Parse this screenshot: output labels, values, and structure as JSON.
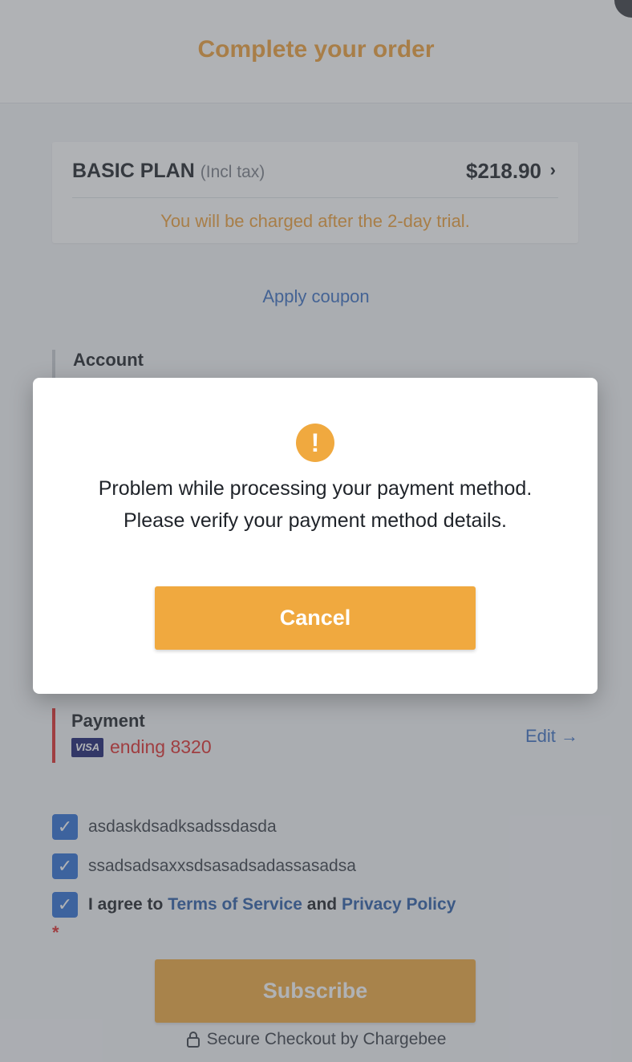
{
  "header": {
    "title": "Complete your order"
  },
  "plan": {
    "name": "BASIC PLAN",
    "tax_note": "(Incl tax)",
    "price": "$218.90",
    "trial_note": "You will be charged after the 2-day trial."
  },
  "coupon": {
    "label": "Apply coupon"
  },
  "account": {
    "title": "Account"
  },
  "payment": {
    "title": "Payment",
    "card_brand": "VISA",
    "card_ending": "ending 8320",
    "edit_label": "Edit →"
  },
  "checkboxes": [
    {
      "label": "asdaskdsadksadssdasda",
      "checked": true
    },
    {
      "label": "ssadsadsaxxsdsasadsadassasadsa",
      "checked": true
    }
  ],
  "agreement": {
    "prefix": "I agree to",
    "terms_link": "Terms of Service",
    "conjunction": "and",
    "privacy_link": "Privacy Policy",
    "required_marker": "*",
    "checked": true
  },
  "subscribe": {
    "label": "Subscribe"
  },
  "secure": {
    "text": "Secure Checkout by Chargebee"
  },
  "modal": {
    "icon": "exclamation-icon",
    "message": "Problem while processing your payment method. Please verify your payment method details.",
    "cancel_label": "Cancel"
  },
  "colors": {
    "accent": "#f0a93f",
    "link": "#3b6fc4",
    "error": "#e02c2c",
    "checkbox": "#2f6fd6"
  }
}
